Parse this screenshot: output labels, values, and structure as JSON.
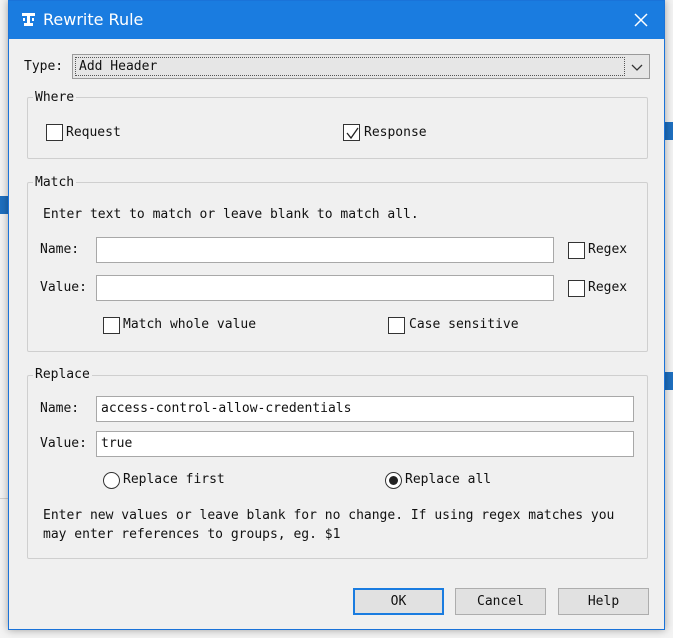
{
  "dialog": {
    "title": "Rewrite Rule"
  },
  "type": {
    "label": "Type:",
    "value": "Add Header"
  },
  "where": {
    "title": "Where",
    "request_label": "Request",
    "request_checked": false,
    "response_label": "Response",
    "response_checked": true
  },
  "match": {
    "title": "Match",
    "hint": "Enter text to match or leave blank to match all.",
    "name_label": "Name:",
    "name_value": "",
    "value_label": "Value:",
    "value_value": "",
    "regex_label": "Regex",
    "whole_value_label": "Match whole value",
    "case_sensitive_label": "Case sensitive"
  },
  "replace": {
    "title": "Replace",
    "name_label": "Name:",
    "name_value": "access-control-allow-credentials",
    "value_label": "Value:",
    "value_value": "true",
    "replace_first_label": "Replace first",
    "replace_all_label": "Replace all",
    "selected": "replace_all",
    "hint_line1": "Enter new values or leave blank for no change. If using regex matches you",
    "hint_line2": "may enter references to groups, eg. $1"
  },
  "buttons": {
    "ok": "OK",
    "cancel": "Cancel",
    "help": "Help"
  },
  "colors": {
    "titlebar": "#1a7ce0",
    "accent": "#1a7ce0"
  }
}
